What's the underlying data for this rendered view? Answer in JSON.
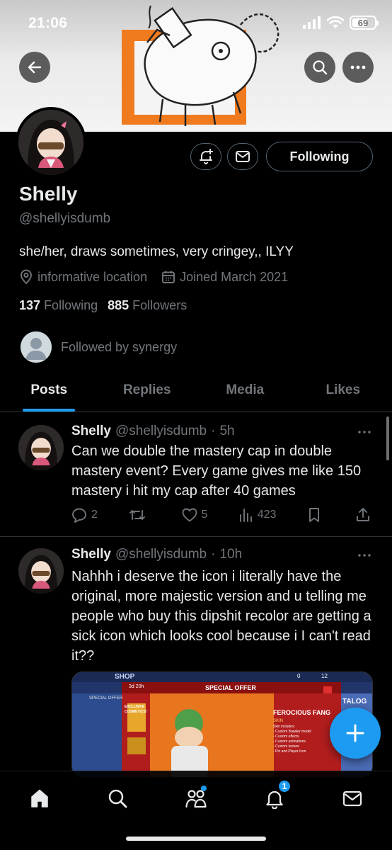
{
  "status_bar": {
    "time": "21:06",
    "battery": "69",
    "battery_level": 0.69
  },
  "profile": {
    "display_name": "Shelly",
    "handle": "@shellyisdumb",
    "bio": "she/her, draws sometimes, very cringey,, ILYY",
    "location": "informative location",
    "joined": "Joined March 2021",
    "following_count": "137",
    "following_label": "Following",
    "followers_count": "885",
    "followers_label": "Followers",
    "followed_by": "Followed by synergy",
    "follow_button_label": "Following"
  },
  "tabs": [
    {
      "label": "Posts",
      "active": true
    },
    {
      "label": "Replies",
      "active": false
    },
    {
      "label": "Media",
      "active": false
    },
    {
      "label": "Likes",
      "active": false
    }
  ],
  "posts": [
    {
      "name": "Shelly",
      "handle": "@shellyisdumb",
      "sep": "·",
      "time": "5h",
      "text": "Can we double the mastery cap in double mastery event? Every game gives me like 150 mastery i hit my cap after 40 games",
      "replies": "2",
      "reposts": "",
      "likes": "5",
      "views": "423"
    },
    {
      "name": "Shelly",
      "handle": "@shellyisdumb",
      "sep": "·",
      "time": "10h",
      "text": "Nahhh i deserve the icon i literally have the original, more majestic version and u telling me people who buy this dipshit recolor are getting a sick icon which looks cool because i I can't read it??",
      "media": {
        "shop": "SHOP",
        "timer": "3d 20h",
        "title": "SPECIAL OFFER",
        "gems": "12",
        "coins": "0",
        "exclusive": "EXCLUSIVE COSMETICS!",
        "skin_name": "FEROCIOUS FANG",
        "skin_type": "SKIN",
        "includes_title": "Skin includes:",
        "includes": [
          "- Custom Brawler model",
          "- Custom effects",
          "- Custom animations",
          "- Custom texture",
          "- Pin and Player Icon"
        ],
        "left_label": "SPECIAL OFFER",
        "catalog": "TALOG"
      }
    }
  ],
  "bottom_nav": {
    "items": [
      "home",
      "search",
      "communities",
      "notifications",
      "messages"
    ],
    "notifications_badge": "1"
  },
  "colors": {
    "accent": "#1d9bf0",
    "background": "#000000",
    "muted": "#71767b",
    "text": "#e7e9ea",
    "banner_orange": "#f07a1e"
  }
}
